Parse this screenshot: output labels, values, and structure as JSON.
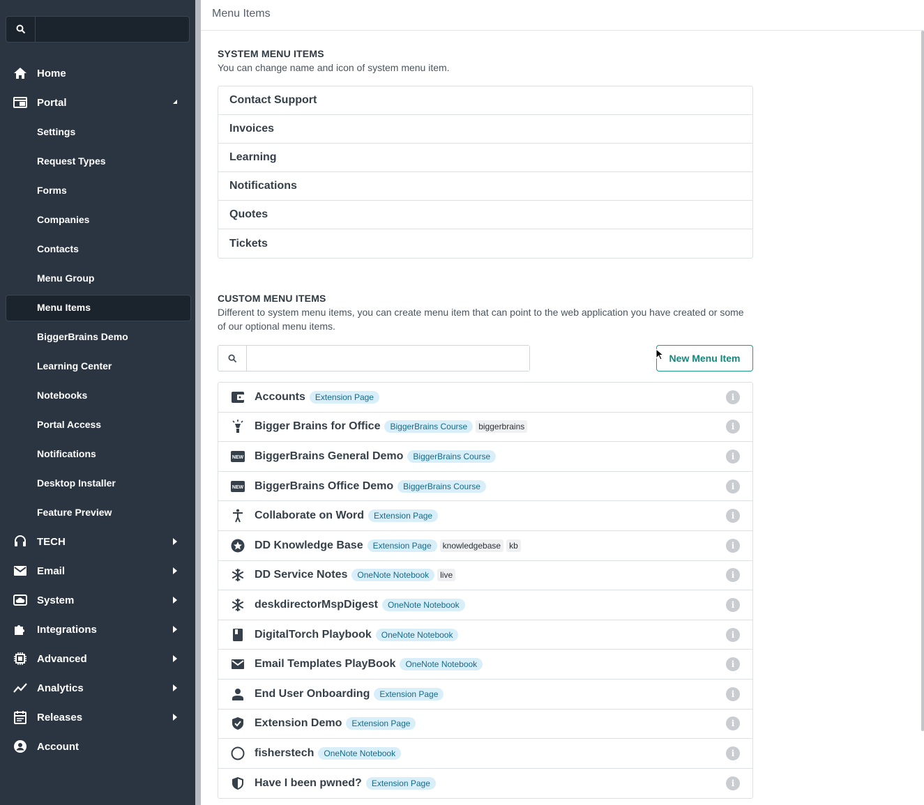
{
  "sidebar": {
    "search_placeholder": "",
    "items": [
      {
        "label": "Home",
        "icon": "home-icon"
      },
      {
        "label": "Portal",
        "icon": "portal-icon",
        "expanded": true
      },
      {
        "label": "Settings"
      },
      {
        "label": "Request Types"
      },
      {
        "label": "Forms"
      },
      {
        "label": "Companies"
      },
      {
        "label": "Contacts"
      },
      {
        "label": "Menu Group"
      },
      {
        "label": "Menu Items",
        "active": true
      },
      {
        "label": "BiggerBrains Demo"
      },
      {
        "label": "Learning Center"
      },
      {
        "label": "Notebooks"
      },
      {
        "label": "Portal Access"
      },
      {
        "label": "Notifications"
      },
      {
        "label": "Desktop Installer"
      },
      {
        "label": "Feature Preview"
      },
      {
        "label": "TECH",
        "icon": "headset-icon"
      },
      {
        "label": "Email",
        "icon": "email-icon"
      },
      {
        "label": "System",
        "icon": "cloud-icon"
      },
      {
        "label": "Integrations",
        "icon": "puzzle-icon"
      },
      {
        "label": "Advanced",
        "icon": "cpu-icon"
      },
      {
        "label": "Analytics",
        "icon": "trend-icon"
      },
      {
        "label": "Releases",
        "icon": "calendar-icon"
      },
      {
        "label": "Account",
        "icon": "account-icon"
      }
    ]
  },
  "header": {
    "title": "Menu Items"
  },
  "system": {
    "title": "SYSTEM MENU ITEMS",
    "description": "You can change name and icon of system menu item.",
    "items": [
      "Contact Support",
      "Invoices",
      "Learning",
      "Notifications",
      "Quotes",
      "Tickets"
    ]
  },
  "custom": {
    "title": "CUSTOM MENU ITEMS",
    "description": "Different to system menu items, you can create menu item that can point to the web application you have created or some of our optional menu items.",
    "search_placeholder": "",
    "new_button": "New Menu Item",
    "items": [
      {
        "name": "Accounts",
        "badge": "Extension Page",
        "tags": [],
        "icon": "wallet-icon"
      },
      {
        "name": "Bigger Brains for Office",
        "badge": "BiggerBrains Course",
        "tags": [
          "biggerbrains"
        ],
        "icon": "lightbulb-icon"
      },
      {
        "name": "BiggerBrains General Demo",
        "badge": "BiggerBrains Course",
        "tags": [],
        "icon": "new-badge-icon"
      },
      {
        "name": "BiggerBrains Office Demo",
        "badge": "BiggerBrains Course",
        "tags": [],
        "icon": "new-badge-icon"
      },
      {
        "name": "Collaborate on Word",
        "badge": "Extension Page",
        "tags": [],
        "icon": "accessibility-icon"
      },
      {
        "name": "DD Knowledge Base",
        "badge": "Extension Page",
        "tags": [
          "knowledgebase",
          "kb"
        ],
        "icon": "star-circle-icon"
      },
      {
        "name": "DD Service Notes",
        "badge": "OneNote Notebook",
        "tags": [
          "live"
        ],
        "icon": "snowflake-icon"
      },
      {
        "name": "deskdirectorMspDigest",
        "badge": "OneNote Notebook",
        "tags": [],
        "icon": "snowflake-icon"
      },
      {
        "name": "DigitalTorch Playbook",
        "badge": "OneNote Notebook",
        "tags": [],
        "icon": "book-icon"
      },
      {
        "name": "Email Templates PlayBook",
        "badge": "OneNote Notebook",
        "tags": [],
        "icon": "email-icon"
      },
      {
        "name": "End User Onboarding",
        "badge": "Extension Page",
        "tags": [],
        "icon": "person-icon"
      },
      {
        "name": "Extension Demo",
        "badge": "Extension Page",
        "tags": [],
        "icon": "shield-check-icon"
      },
      {
        "name": "fisherstech",
        "badge": "OneNote Notebook",
        "tags": [],
        "icon": "circle-icon"
      },
      {
        "name": "Have I been pwned?",
        "badge": "Extension Page",
        "tags": [],
        "icon": "shield-half-icon"
      }
    ]
  },
  "info_glyph": "i"
}
